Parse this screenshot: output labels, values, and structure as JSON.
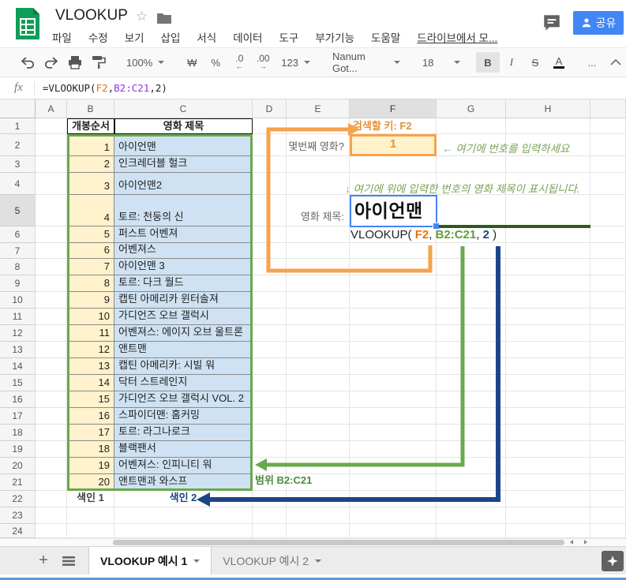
{
  "header": {
    "title": "VLOOKUP",
    "menu": [
      "파일",
      "수정",
      "보기",
      "삽입",
      "서식",
      "데이터",
      "도구",
      "부가기능",
      "도움말",
      "드라이브에서 모..."
    ],
    "share": "공유"
  },
  "toolbar": {
    "zoom": "100%",
    "currency": "₩",
    "percent": "%",
    "dec_decrease": ".0",
    "dec_decrease_arrow": "←",
    "dec_increase": ".00",
    "dec_increase_arrow": "→",
    "number_format": "123",
    "font_name": "Nanum Got...",
    "font_size": "18",
    "bold": "B",
    "italic": "I",
    "strikethrough": "S",
    "text_color": "A",
    "more": "..."
  },
  "formula_bar": {
    "fx": "fx",
    "formula": [
      {
        "text": "=VLOOKUP(",
        "color": "default"
      },
      {
        "text": "F2",
        "color": "orange"
      },
      {
        "text": ",",
        "color": "default"
      },
      {
        "text": "B2:C21",
        "color": "purple"
      },
      {
        "text": ",2)",
        "color": "default"
      }
    ]
  },
  "grid": {
    "col_headers": [
      "A",
      "B",
      "C",
      "D",
      "E",
      "F",
      "G",
      "H",
      ""
    ],
    "row_count": 24,
    "table": {
      "col1_header": "개봉순서",
      "col2_header": "영화 제목",
      "movies": [
        [
          "1",
          "아이언맨"
        ],
        [
          "2",
          "인크레더블 헐크"
        ],
        [
          "3",
          "아이언맨2"
        ],
        [
          "4",
          "토르: 천둥의 신"
        ],
        [
          "5",
          "퍼스트 어벤져"
        ],
        [
          "6",
          "어벤져스"
        ],
        [
          "7",
          "아이언맨 3"
        ],
        [
          "8",
          "토르: 다크 월드"
        ],
        [
          "9",
          "캡틴 아메리카 윈터솔져"
        ],
        [
          "10",
          "가디언즈 오브 갤럭시"
        ],
        [
          "11",
          "어벤져스: 에이지 오브 울트론"
        ],
        [
          "12",
          "앤트맨"
        ],
        [
          "13",
          "캡틴 아메리카: 시빌 워"
        ],
        [
          "14",
          "닥터 스트레인지"
        ],
        [
          "15",
          "가디언즈 오브 갤럭시 VOL. 2"
        ],
        [
          "16",
          "스파이더맨: 홈커밍"
        ],
        [
          "17",
          "토르: 라그나로크"
        ],
        [
          "18",
          "블랙팬서"
        ],
        [
          "19",
          "어벤져스: 인피니티 워"
        ],
        [
          "20",
          "앤트맨과 와스프"
        ]
      ],
      "index1": "색인 1",
      "index2": "색인 2"
    },
    "cells": {
      "search_key_label": "검색할 키: F2",
      "lookup_value": "1",
      "question_label": "몇번째 영화?",
      "result_label": "영화 제목:",
      "result_value": "아이언맨"
    },
    "inline_formula": [
      {
        "text": "VLOOKUP( ",
        "color": "default"
      },
      {
        "text": "F2",
        "color": "orange"
      },
      {
        "text": ", ",
        "color": "default"
      },
      {
        "text": "B2:C21",
        "color": "green"
      },
      {
        "text": ", ",
        "color": "default"
      },
      {
        "text": "2",
        "color": "blue"
      },
      {
        "text": " )",
        "color": "default"
      }
    ],
    "annotations": {
      "enter_number": "←  여기에 번호를 입력하세요",
      "result_note": "↓ 여기에 위에 입력한 번호의 영화 제목이 표시됩니다.",
      "range_label": "범위 B2:C21"
    }
  },
  "sheet_bar": {
    "tabs": [
      {
        "label": "VLOOKUP 예시 1",
        "active": true
      },
      {
        "label": "VLOOKUP 예시 2",
        "active": false
      }
    ]
  },
  "colors": {
    "annotation_orange": "#f6a34d",
    "text_orange": "#e69138",
    "annotation_green": "#6aa84f",
    "dark_green": "#2e5b16",
    "formula_green": "#5f9e3e",
    "annotation_blue": "#1c4587",
    "selection_blue": "#4285f4",
    "share_blue": "#4285f4",
    "cell_yellow": "#fff2cc",
    "cell_blue": "#cfe2f3",
    "logo_green": "#0f9d58"
  }
}
